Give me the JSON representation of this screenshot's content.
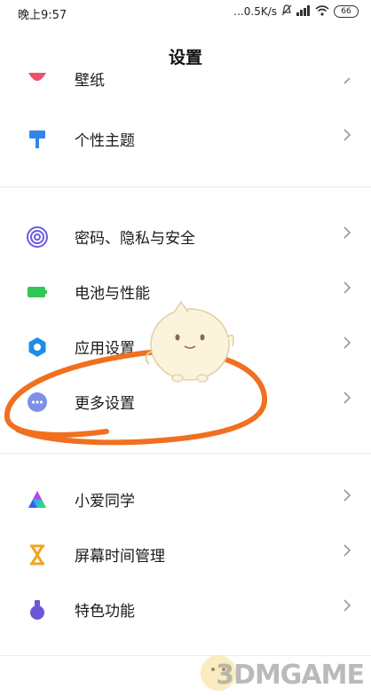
{
  "status_bar": {
    "time": "晚上9:57",
    "network_speed": "...0.5K/s",
    "battery": "66"
  },
  "header": {
    "title": "设置"
  },
  "top_partial_item": {
    "label": "壁纸"
  },
  "groups": [
    {
      "items": [
        {
          "label": "个性主题",
          "icon": "paint-roller-icon"
        }
      ]
    },
    {
      "items": [
        {
          "label": "密码、隐私与安全",
          "icon": "fingerprint-icon"
        },
        {
          "label": "电池与性能",
          "icon": "battery-icon"
        },
        {
          "label": "应用设置",
          "icon": "gear-icon"
        },
        {
          "label": "更多设置",
          "icon": "more-dots-icon"
        }
      ]
    },
    {
      "items": [
        {
          "label": "小爱同学",
          "icon": "xiaoai-icon"
        },
        {
          "label": "屏幕时间管理",
          "icon": "hourglass-icon"
        },
        {
          "label": "特色功能",
          "icon": "flask-icon"
        }
      ]
    }
  ],
  "watermark": "3DMGAME",
  "colors": {
    "theme_icon": "#2f86e8",
    "privacy_icon": "#6a5be0",
    "battery_icon": "#31c859",
    "gear_icon": "#1f8de6",
    "more_icon": "#7d8fe6",
    "hourglass_icon": "#f2a51f",
    "flask_icon": "#6c57d8",
    "annotation": "#f07020"
  }
}
